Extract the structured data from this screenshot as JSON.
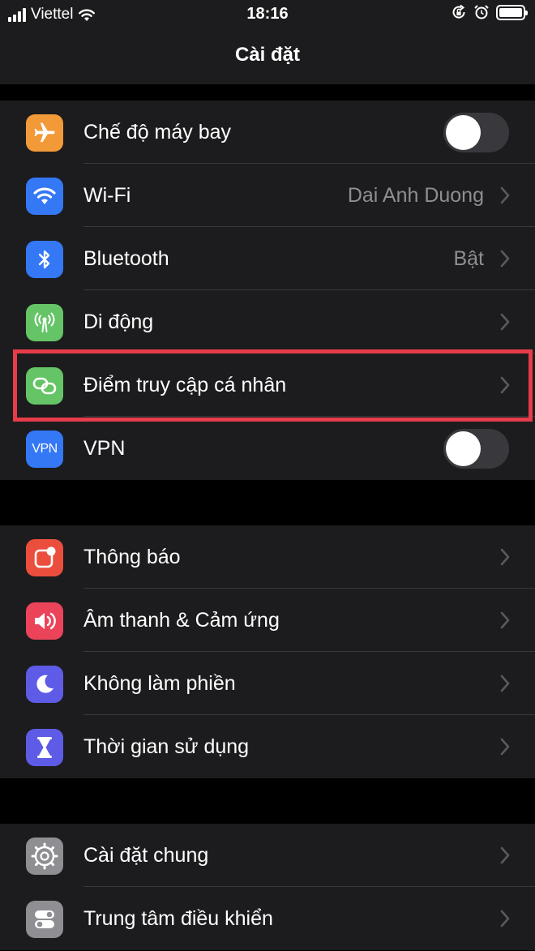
{
  "status_bar": {
    "carrier": "Viettel",
    "time": "18:16",
    "battery_level": 1.0
  },
  "nav": {
    "title": "Cài đặt"
  },
  "groups": [
    {
      "rows": [
        {
          "label": "Chế độ máy bay",
          "icon": "airplane-icon",
          "icon_color": "#f19a37",
          "toggle": false
        },
        {
          "label": "Wi-Fi",
          "value": "Dai Anh Duong",
          "icon": "wifi-icon",
          "icon_color": "#3478f6"
        },
        {
          "label": "Bluetooth",
          "value": "Bật",
          "icon": "bluetooth-icon",
          "icon_color": "#3478f6"
        },
        {
          "label": "Di động",
          "icon": "cellular-icon",
          "icon_color": "#65c466"
        },
        {
          "label": "Điểm truy cập cá nhân",
          "icon": "personal-hotspot-icon",
          "icon_color": "#65c466",
          "highlighted": true
        },
        {
          "label": "VPN",
          "icon_text": "VPN",
          "icon": "vpn-icon",
          "icon_color": "#3478f6",
          "toggle": false
        }
      ]
    },
    {
      "rows": [
        {
          "label": "Thông báo",
          "icon": "notifications-icon",
          "icon_color": "#eb4e3d"
        },
        {
          "label": "Âm thanh & Cảm ứng",
          "icon": "sound-icon",
          "icon_color": "#eb445a"
        },
        {
          "label": "Không làm phiền",
          "icon": "moon-icon",
          "icon_color": "#5e5ce6"
        },
        {
          "label": "Thời gian sử dụng",
          "icon": "hourglass-icon",
          "icon_color": "#5e5ce6"
        }
      ]
    },
    {
      "rows": [
        {
          "label": "Cài đặt chung",
          "icon": "gear-icon",
          "icon_color": "#8e8e93"
        },
        {
          "label": "Trung tâm điều khiển",
          "icon": "control-center-icon",
          "icon_color": "#8e8e93"
        }
      ]
    }
  ]
}
